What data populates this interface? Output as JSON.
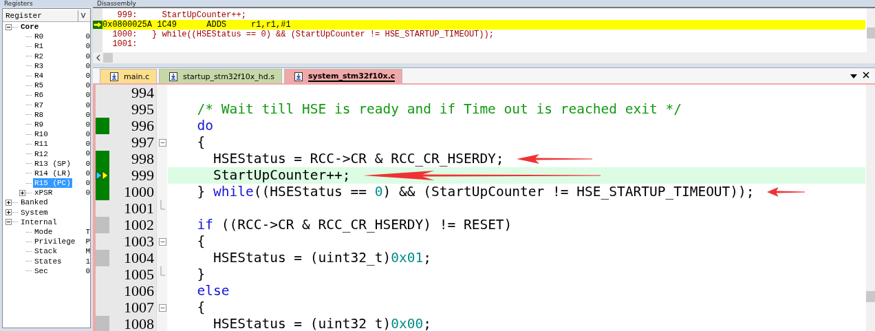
{
  "registers": {
    "title": "Registers",
    "columns": [
      "Register",
      "V"
    ],
    "tree": [
      {
        "name": "Core",
        "bold": true,
        "expanded": true,
        "children": [
          {
            "name": "R0",
            "value": "0",
            "selected": false
          },
          {
            "name": "R1",
            "value": "0",
            "selected": false
          },
          {
            "name": "R2",
            "value": "0",
            "selected": false
          },
          {
            "name": "R3",
            "value": "0",
            "selected": false
          },
          {
            "name": "R4",
            "value": "0",
            "selected": false
          },
          {
            "name": "R5",
            "value": "0",
            "selected": false
          },
          {
            "name": "R6",
            "value": "0",
            "selected": false
          },
          {
            "name": "R7",
            "value": "0",
            "selected": false
          },
          {
            "name": "R8",
            "value": "0",
            "selected": false
          },
          {
            "name": "R9",
            "value": "0",
            "selected": false
          },
          {
            "name": "R10",
            "value": "0",
            "selected": false
          },
          {
            "name": "R11",
            "value": "0",
            "selected": false
          },
          {
            "name": "R12",
            "value": "0",
            "selected": false
          },
          {
            "name": "R13 (SP)",
            "value": "0",
            "selected": false
          },
          {
            "name": "R14 (LR)",
            "value": "0",
            "selected": false
          },
          {
            "name": "R15 (PC)",
            "value": "0",
            "selected": true
          },
          {
            "name": "xPSR",
            "value": "0",
            "selected": false,
            "expanded": false
          }
        ]
      },
      {
        "name": "Banked",
        "bold": false,
        "expanded": false
      },
      {
        "name": "System",
        "bold": false,
        "expanded": false
      },
      {
        "name": "Internal",
        "bold": false,
        "expanded": true,
        "children": [
          {
            "name": "Mode",
            "value": "T",
            "selected": false
          },
          {
            "name": "Privilege",
            "value": "P",
            "selected": false
          },
          {
            "name": "Stack",
            "value": "M",
            "selected": false
          },
          {
            "name": "States",
            "value": "1",
            "selected": false
          },
          {
            "name": "Sec",
            "value": "0",
            "selected": false
          }
        ]
      }
    ]
  },
  "disassembly": {
    "title": "Disassembly",
    "lines": [
      {
        "text": "   999:     StartUpCounter++;",
        "current": false
      },
      {
        "text": "0x0800025A 1C49      ADDS     r1,r1,#1",
        "current": true
      },
      {
        "text": "  1000:   } while((HSEStatus == 0) && (StartUpCounter != HSE_STARTUP_TIMEOUT));",
        "current": false
      },
      {
        "text": "  1001:",
        "current": false
      }
    ]
  },
  "tabs": [
    {
      "label": "main.c",
      "color": "#fbdf8c",
      "selected": false
    },
    {
      "label": "startup_stm32f10x_hd.s",
      "color": "#c6d8a8",
      "selected": false
    },
    {
      "label": "system_stm32f10x.c",
      "color": "#f0a8a8",
      "selected": true
    }
  ],
  "editor": {
    "lines": [
      {
        "number": "994",
        "kind": "plain",
        "current": false,
        "arrow": false
      },
      {
        "number": "995",
        "kind": "plain",
        "current": false,
        "arrow": false,
        "code": [
          {
            "t": "  /* Wait till HSE is ready and if Time out is reached exit */",
            "kind": "comment"
          }
        ]
      },
      {
        "number": "996",
        "kind": "plain",
        "color": "#008000",
        "current": false,
        "arrow": false,
        "code": [
          {
            "t": "  do",
            "kind": "keyword"
          }
        ]
      },
      {
        "number": "997",
        "kind": "blockstart",
        "current": false,
        "arrow": false,
        "code": [
          {
            "t": "  {",
            "kind": "text"
          }
        ]
      },
      {
        "number": "998",
        "kind": "plain",
        "color": "#008000",
        "current": false,
        "arrow": true,
        "code": [
          {
            "t": "    HSEStatus = RCC->CR & RCC_CR_HSERDY;",
            "kind": "text"
          }
        ]
      },
      {
        "number": "999",
        "kind": "plain",
        "color": "#008000",
        "current": true,
        "arrow": true,
        "code": [
          {
            "t": "    StartUpCounter++;",
            "kind": "text"
          }
        ]
      },
      {
        "number": "1000",
        "kind": "plain",
        "color": "#008000",
        "current": false,
        "arrow": true,
        "code": [
          {
            "t": "  } ",
            "kind": "text"
          },
          {
            "t": "while",
            "kind": "keyword"
          },
          {
            "t": "((HSEStatus == ",
            "kind": "text"
          },
          {
            "t": "0",
            "kind": "number"
          },
          {
            "t": ") && (StartUpCounter != HSE_STARTUP_TIMEOUT));",
            "kind": "text"
          }
        ]
      },
      {
        "number": "1001",
        "kind": "blockend",
        "current": false,
        "arrow": false
      },
      {
        "number": "1002",
        "kind": "plain",
        "color": "#c0c0c0",
        "current": false,
        "arrow": false,
        "code": [
          {
            "t": "  if",
            "kind": "keyword"
          },
          {
            "t": " ((RCC->CR & RCC_CR_HSERDY) != RESET)",
            "kind": "text"
          }
        ]
      },
      {
        "number": "1003",
        "kind": "blockstart",
        "current": false,
        "arrow": false,
        "code": [
          {
            "t": "  {",
            "kind": "text"
          }
        ]
      },
      {
        "number": "1004",
        "kind": "plain",
        "color": "#c0c0c0",
        "current": false,
        "arrow": false,
        "code": [
          {
            "t": "    HSEStatus = (uint32_t)",
            "kind": "text"
          },
          {
            "t": "0x01",
            "kind": "number"
          },
          {
            "t": ";",
            "kind": "text"
          }
        ]
      },
      {
        "number": "1005",
        "kind": "blockend",
        "current": false,
        "arrow": false,
        "code": [
          {
            "t": "  }",
            "kind": "text"
          }
        ]
      },
      {
        "number": "1006",
        "kind": "plain",
        "current": false,
        "arrow": false,
        "code": [
          {
            "t": "  else",
            "kind": "keyword"
          }
        ]
      },
      {
        "number": "1007",
        "kind": "blockstart",
        "current": false,
        "arrow": false,
        "code": [
          {
            "t": "  {",
            "kind": "text"
          }
        ]
      },
      {
        "number": "1008",
        "kind": "plain",
        "color": "#c0c0c0",
        "current": false,
        "arrow": false,
        "code": [
          {
            "t": "    HSEStatus = (uint32_t)",
            "kind": "text"
          },
          {
            "t": "0x00",
            "kind": "number"
          },
          {
            "t": ";",
            "kind": "text"
          }
        ]
      }
    ]
  }
}
